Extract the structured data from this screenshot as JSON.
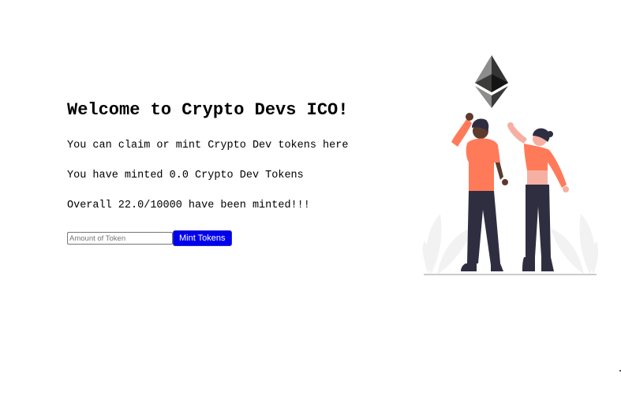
{
  "page": {
    "title": "Welcome to Crypto Devs ICO!",
    "claim_text": "You can claim or mint Crypto Dev tokens here",
    "minted_text": "You have minted 0.0 Crypto Dev Tokens",
    "overall_text": "Overall 22.0/10000 have been minted!!!"
  },
  "form": {
    "amount_placeholder": "Amount of Token",
    "amount_value": "",
    "mint_button_label": "Mint Tokens"
  },
  "colors": {
    "button_bg": "#0000ee",
    "shirt": "#ff7a59",
    "pants": "#2f2e41",
    "skin_dark": "#5c3a2e",
    "skin_light": "#f6b0a3",
    "eth_dark": "#343434",
    "eth_mid": "#8c8c8c",
    "foliage": "#f2f2f2",
    "ground": "#cccccc"
  },
  "icons": {
    "hero": "ethereum-celebration-illustration"
  }
}
